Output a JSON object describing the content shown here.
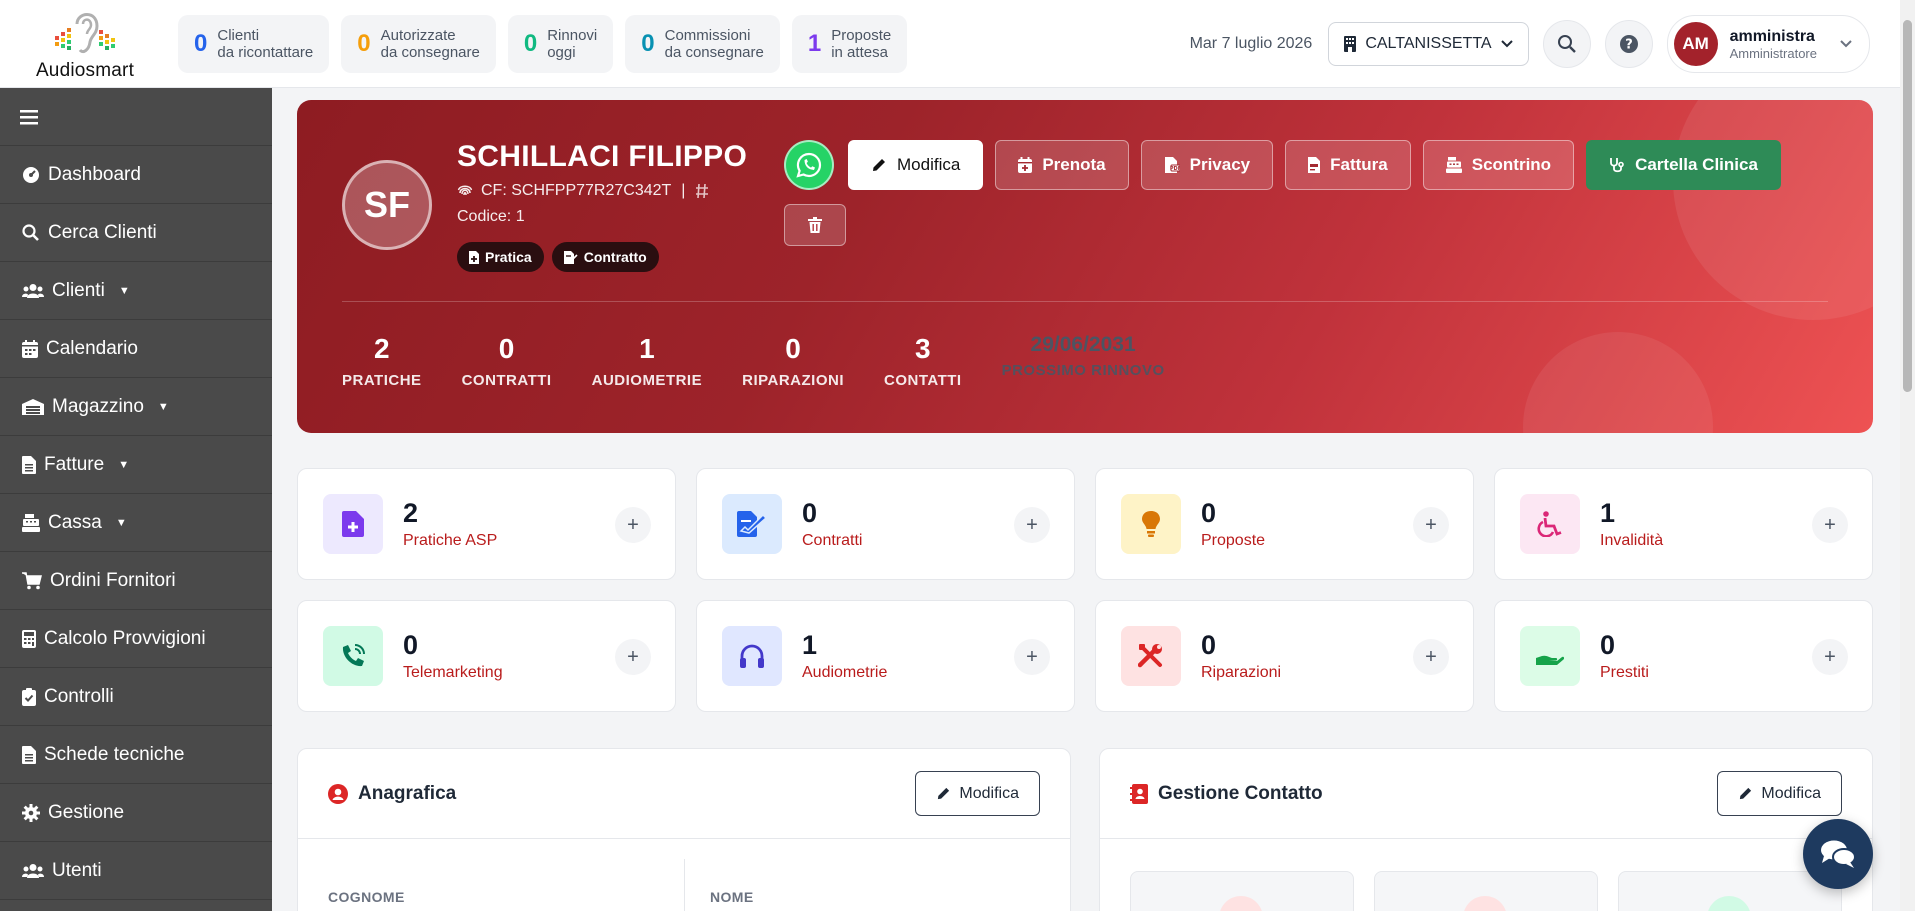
{
  "brand": {
    "name_prefix": "Audio",
    "name_suffix": "smart"
  },
  "top_stats": [
    {
      "value": "0",
      "label1": "Clienti",
      "label2": "da ricontattare",
      "color": "#2563eb"
    },
    {
      "value": "0",
      "label1": "Autorizzate",
      "label2": "da consegnare",
      "color": "#f59e0b"
    },
    {
      "value": "0",
      "label1": "Rinnovi",
      "label2": "oggi",
      "color": "#10b981"
    },
    {
      "value": "0",
      "label1": "Commissioni",
      "label2": "da consegnare",
      "color": "#0891b2"
    },
    {
      "value": "1",
      "label1": "Proposte",
      "label2": "in attesa",
      "color": "#7c3aed"
    }
  ],
  "header": {
    "date": "Mar 7 luglio 2026",
    "branch": "CALTANISSETTA",
    "user": {
      "initials": "AM",
      "name": "amministra",
      "role": "Amministratore"
    }
  },
  "sidebar": {
    "items": [
      {
        "label": "Dashboard",
        "icon": "gauge-icon",
        "caret": ""
      },
      {
        "label": "Cerca Clienti",
        "icon": "search-icon",
        "caret": ""
      },
      {
        "label": "Clienti",
        "icon": "users-icon",
        "caret": "▼"
      },
      {
        "label": "Calendario",
        "icon": "calendar-icon",
        "caret": ""
      },
      {
        "label": "Magazzino",
        "icon": "warehouse-icon",
        "caret": "▼"
      },
      {
        "label": "Fatture",
        "icon": "document-icon",
        "caret": "▼"
      },
      {
        "label": "Cassa",
        "icon": "cash-register-icon",
        "caret": "▼"
      },
      {
        "label": "Ordini Fornitori",
        "icon": "cart-icon",
        "caret": ""
      },
      {
        "label": "Calcolo Provvigioni",
        "icon": "calculator-icon",
        "caret": ""
      },
      {
        "label": "Controlli",
        "icon": "clipboard-check-icon",
        "caret": ""
      },
      {
        "label": "Schede tecniche",
        "icon": "file-icon",
        "caret": ""
      },
      {
        "label": "Gestione",
        "icon": "gear-icon",
        "caret": ""
      },
      {
        "label": "Utenti",
        "icon": "users-icon",
        "caret": ""
      }
    ]
  },
  "client": {
    "initials": "SF",
    "name": "SCHILLACI FILIPPO",
    "cf": "CF: SCHFPP77R27C342T",
    "cf_separator": "|",
    "code": "Codice: 1",
    "tags": [
      "Pratica",
      "Contratto"
    ],
    "actions": {
      "edit": "Modifica",
      "book": "Prenota",
      "privacy": "Privacy",
      "invoice": "Fattura",
      "receipt": "Scontrino",
      "clinical": "Cartella Clinica"
    },
    "stats": [
      {
        "value": "2",
        "label": "PRATICHE"
      },
      {
        "value": "0",
        "label": "CONTRATTI"
      },
      {
        "value": "1",
        "label": "AUDIOMETRIE"
      },
      {
        "value": "0",
        "label": "RIPARAZIONI"
      },
      {
        "value": "3",
        "label": "CONTATTI"
      },
      {
        "value": "29/06/2031",
        "label": "PROSSIMO RINNOVO"
      }
    ]
  },
  "cards": [
    {
      "value": "2",
      "label": "Pratiche ASP",
      "icon": "file-medical-icon",
      "bg": "#ede9fe",
      "fg": "#7c3aed"
    },
    {
      "value": "0",
      "label": "Contratti",
      "icon": "file-signature-icon",
      "bg": "#dbeafe",
      "fg": "#2563eb"
    },
    {
      "value": "0",
      "label": "Proposte",
      "icon": "lightbulb-icon",
      "bg": "#fef3c7",
      "fg": "#d97706"
    },
    {
      "value": "1",
      "label": "Invalidità",
      "icon": "wheelchair-icon",
      "bg": "#fce7f3",
      "fg": "#db2777"
    },
    {
      "value": "0",
      "label": "Telemarketing",
      "icon": "phone-volume-icon",
      "bg": "#d1fae5",
      "fg": "#059669"
    },
    {
      "value": "1",
      "label": "Audiometrie",
      "icon": "headphones-icon",
      "bg": "#e0e7ff",
      "fg": "#4338ca"
    },
    {
      "value": "0",
      "label": "Riparazioni",
      "icon": "tools-icon",
      "bg": "#fee2e2",
      "fg": "#dc2626"
    },
    {
      "value": "0",
      "label": "Prestiti",
      "icon": "hand-holding-icon",
      "bg": "#dcfce7",
      "fg": "#16a34a"
    }
  ],
  "anagrafica": {
    "title": "Anagrafica",
    "edit": "Modifica",
    "field1": "COGNOME",
    "field2": "NOME"
  },
  "contatto": {
    "title": "Gestione Contatto",
    "edit": "Modifica"
  },
  "colors": {
    "accent": "#a3222b",
    "sidebar": "#4a4a4a",
    "green": "#2e8b57"
  }
}
